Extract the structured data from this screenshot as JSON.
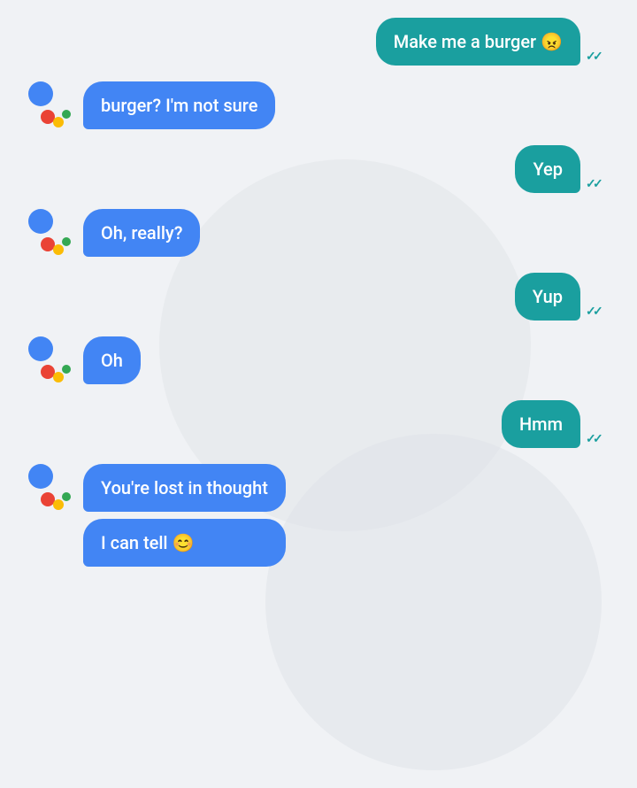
{
  "background": {
    "color": "#f0f2f5"
  },
  "messages": [
    {
      "id": "msg1",
      "type": "user",
      "text": "Make me a burger 😠",
      "read": true
    },
    {
      "id": "msg2",
      "type": "assistant",
      "bubbles": [
        "burger? I'm not sure"
      ]
    },
    {
      "id": "msg3",
      "type": "user",
      "text": "Yep",
      "read": true
    },
    {
      "id": "msg4",
      "type": "assistant",
      "bubbles": [
        "Oh, really?"
      ]
    },
    {
      "id": "msg5",
      "type": "user",
      "text": "Yup",
      "read": true
    },
    {
      "id": "msg6",
      "type": "assistant",
      "bubbles": [
        "Oh"
      ]
    },
    {
      "id": "msg7",
      "type": "user",
      "text": "Hmm",
      "read": true
    },
    {
      "id": "msg8",
      "type": "assistant",
      "bubbles": [
        "You're lost in thought",
        "I can tell 😊"
      ]
    }
  ]
}
